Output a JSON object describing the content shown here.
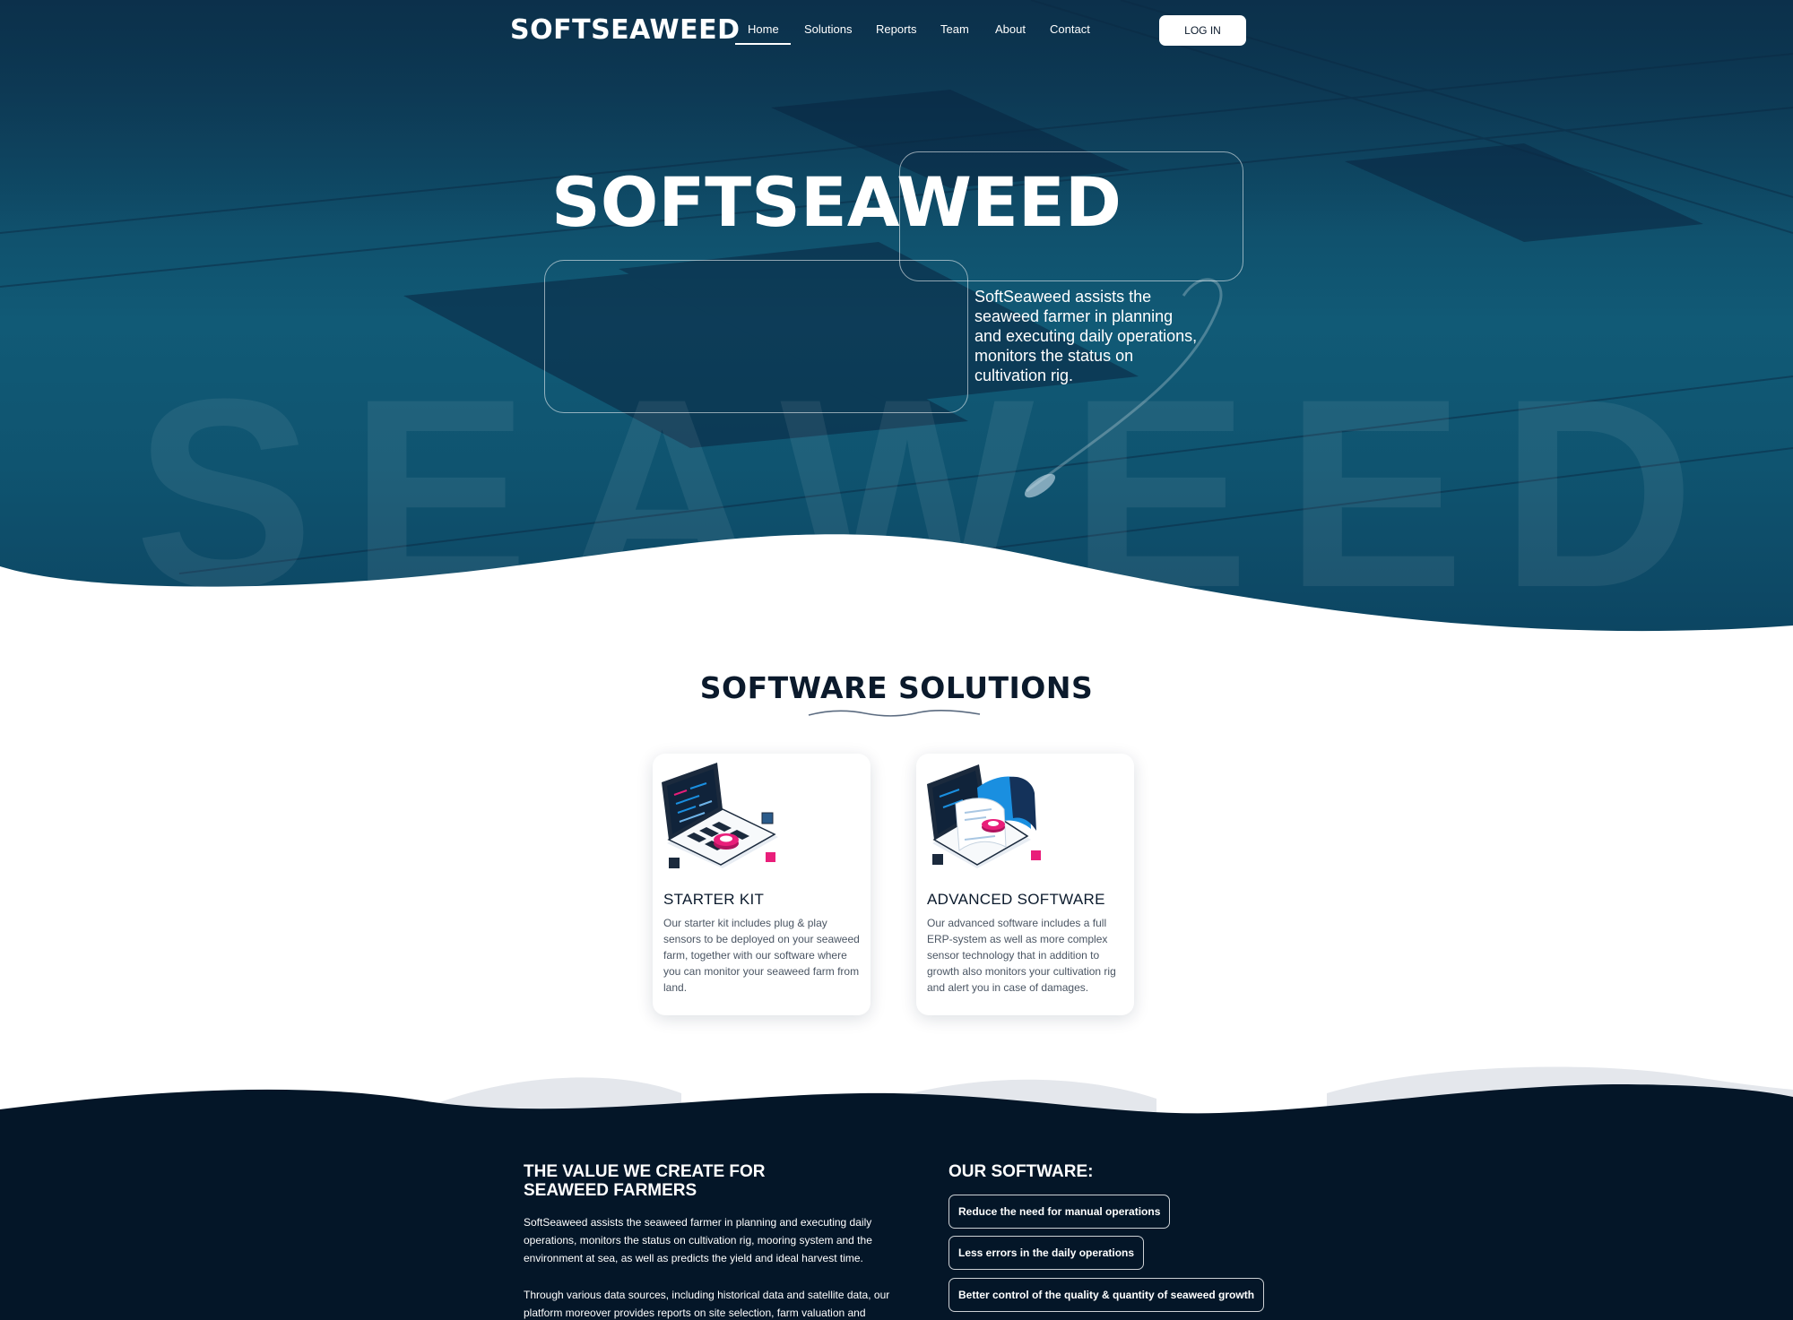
{
  "colors": {
    "hero_ocean": "#0f4a66",
    "navy": "#0b1a2c",
    "footer_bg": "#041628",
    "accent_pink": "#e91e7a",
    "accent_blue": "#1a8fe0",
    "white": "#ffffff"
  },
  "nav": {
    "logo": "SOFTSEAWEED",
    "items": [
      {
        "label": "Home",
        "active": true
      },
      {
        "label": "Solutions"
      },
      {
        "label": "Reports"
      },
      {
        "label": "Team"
      },
      {
        "label": "About"
      },
      {
        "label": "Contact"
      }
    ],
    "login_label": "LOG IN"
  },
  "hero": {
    "title": "SOFTSEAWEED",
    "background_word": "SEAWEED",
    "description": "SoftSeaweed assists the seaweed farmer in planning and executing daily operations, monitors the status on cultivation rig."
  },
  "solutions": {
    "title": "SOFTWARE SOLUTIONS",
    "cards": [
      {
        "illustration": "laptop-sensor-icon",
        "title": "STARTER KIT",
        "text": "Our starter kit includes plug & play sensors to be deployed on your seaweed farm, together with our software where you can monitor your seaweed farm from land."
      },
      {
        "illustration": "laptop-document-icon",
        "title": "ADVANCED SOFTWARE",
        "text": "Our advanced software includes a full ERP-system as well as more complex sensor technology that in addition to growth also monitors your cultivation rig and alert you in case of damages."
      }
    ]
  },
  "value": {
    "title": "THE VALUE WE CREATE FOR SEAWEED FARMERS",
    "paragraphs": [
      "SoftSeaweed assists the seaweed farmer in planning and executing daily operations, monitors the status on cultivation rig, mooring system and the environment at sea, as well as predicts the yield and ideal harvest time.",
      "Through various data sources, including historical data and satellite data, our platform moreover provides reports on site selection, farm valuation and"
    ]
  },
  "software": {
    "title": "OUR SOFTWARE:",
    "items": [
      "Reduce the need for manual operations",
      "Less errors in the daily operations",
      "Better control of the quality & quantity of seaweed growth"
    ]
  }
}
